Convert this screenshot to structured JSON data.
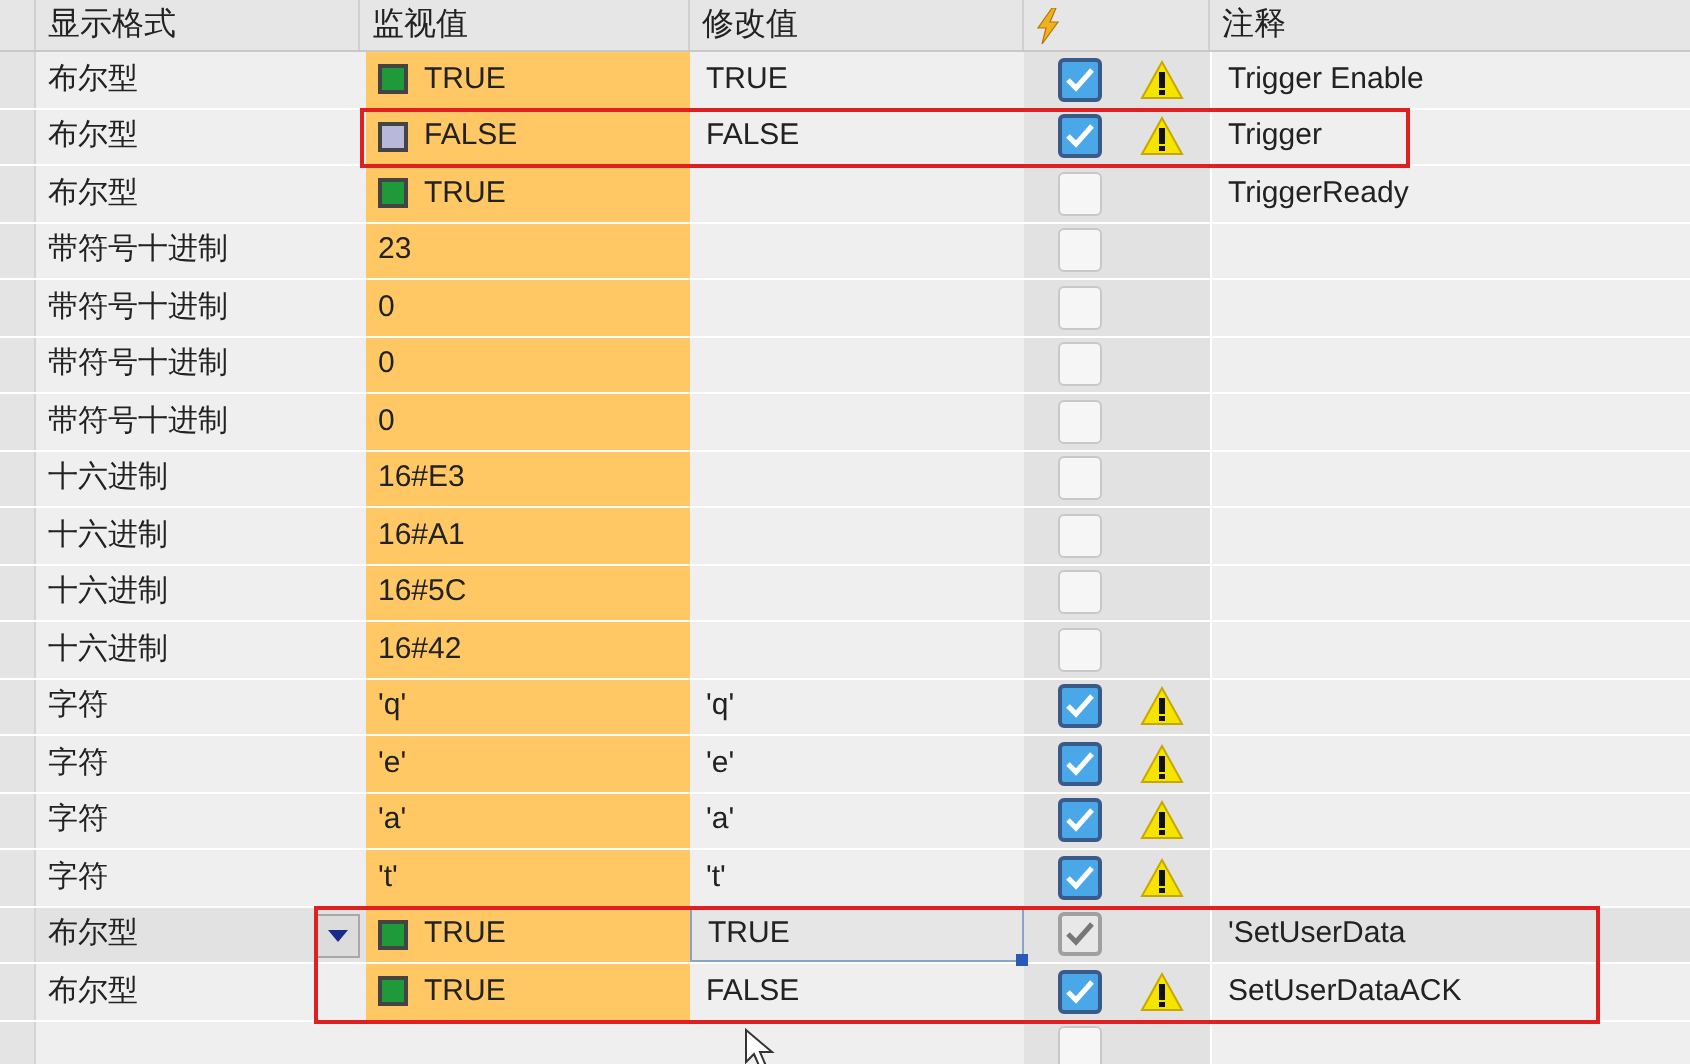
{
  "columns": [
    "显示格式",
    "监视值",
    "修改值",
    "注释"
  ],
  "rows": [
    {
      "format": "布尔型",
      "monitor": "TRUE",
      "bool_state": true,
      "modify": "TRUE",
      "checked": true,
      "warning": true,
      "comment": "Trigger Enable",
      "selected": false,
      "marked": false
    },
    {
      "format": "布尔型",
      "monitor": "FALSE",
      "bool_state": false,
      "modify": "FALSE",
      "checked": true,
      "warning": true,
      "comment": "Trigger",
      "selected": false,
      "marked": true
    },
    {
      "format": "布尔型",
      "monitor": "TRUE",
      "bool_state": true,
      "checked": false,
      "warning": false,
      "comment": "TriggerReady",
      "selected": false,
      "marked": false
    },
    {
      "format": "带符号十进制",
      "monitor": "23",
      "checked": false,
      "warning": false,
      "selected": false,
      "marked": false
    },
    {
      "format": "带符号十进制",
      "monitor": "0",
      "checked": false,
      "warning": false,
      "selected": false,
      "marked": false
    },
    {
      "format": "带符号十进制",
      "monitor": "0",
      "checked": false,
      "warning": false,
      "selected": false,
      "marked": false
    },
    {
      "format": "带符号十进制",
      "monitor": "0",
      "checked": false,
      "warning": false,
      "selected": false,
      "marked": false
    },
    {
      "format": "十六进制",
      "monitor": "16#E3",
      "checked": false,
      "warning": false,
      "selected": false,
      "marked": false
    },
    {
      "format": "十六进制",
      "monitor": "16#A1",
      "checked": false,
      "warning": false,
      "selected": false,
      "marked": false
    },
    {
      "format": "十六进制",
      "monitor": "16#5C",
      "checked": false,
      "warning": false,
      "selected": false,
      "marked": false
    },
    {
      "format": "十六进制",
      "monitor": "16#42",
      "checked": false,
      "warning": false,
      "selected": false,
      "marked": false
    },
    {
      "format": "字符",
      "monitor": "'q'",
      "modify": "'q'",
      "checked": true,
      "warning": true,
      "selected": false,
      "marked": false
    },
    {
      "format": "字符",
      "monitor": "'e'",
      "modify": "'e'",
      "checked": true,
      "warning": true,
      "selected": false,
      "marked": false
    },
    {
      "format": "字符",
      "monitor": "'a'",
      "modify": "'a'",
      "checked": true,
      "warning": true,
      "selected": false,
      "marked": false
    },
    {
      "format": "字符",
      "monitor": "'t'",
      "modify": "'t'",
      "checked": true,
      "warning": true,
      "selected": false,
      "marked": false
    },
    {
      "format": "布尔型",
      "monitor": "TRUE",
      "bool_state": true,
      "modify": "TRUE",
      "checked": true,
      "warning": false,
      "comment": "'SetUserData",
      "selected": true,
      "marked": true
    },
    {
      "format": "布尔型",
      "monitor": "TRUE",
      "bool_state": true,
      "modify": "FALSE",
      "checked": true,
      "warning": true,
      "comment": "SetUserDataACK",
      "selected": false,
      "marked": true
    },
    {
      "checked": false,
      "warning": false,
      "selected": false,
      "marked": false
    }
  ]
}
